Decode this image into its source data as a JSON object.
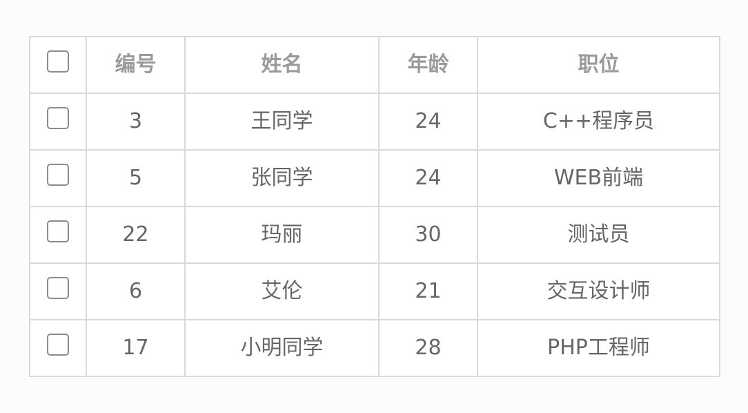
{
  "table": {
    "headers": {
      "select_all": "",
      "id": "编号",
      "name": "姓名",
      "age": "年龄",
      "position": "职位"
    },
    "rows": [
      {
        "id": "3",
        "name": "王同学",
        "age": "24",
        "position": "C++程序员",
        "checked": false
      },
      {
        "id": "5",
        "name": "张同学",
        "age": "24",
        "position": "WEB前端",
        "checked": false
      },
      {
        "id": "22",
        "name": "玛丽",
        "age": "30",
        "position": "测试员",
        "checked": false
      },
      {
        "id": "6",
        "name": "艾伦",
        "age": "21",
        "position": "交互设计师",
        "checked": false
      },
      {
        "id": "17",
        "name": "小明同学",
        "age": "28",
        "position": "PHP工程师",
        "checked": false
      }
    ]
  },
  "colors": {
    "border": "#d9d9d9",
    "header_text": "#9a9a9a",
    "cell_text": "#666666",
    "checkbox_border": "#8c8c8c"
  }
}
